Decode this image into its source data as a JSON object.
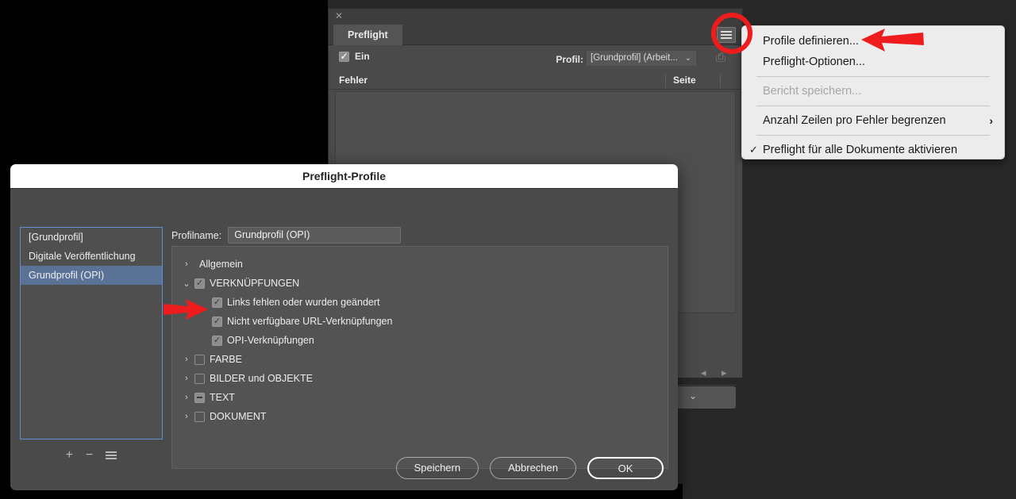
{
  "preflight_panel": {
    "close_icon": "close-icon",
    "collapse_icon": "collapse-panel-icon",
    "tab_label": "Preflight",
    "menu_icon": "panel-menu-icon",
    "enabled_label": "Ein",
    "enabled_checked": true,
    "profile_label": "Profil:",
    "profile_value": "[Grundprofil] (Arbeit...",
    "profile_chevron": "⌄",
    "embed_icon": "embed-profile-icon",
    "columns": [
      "Fehler",
      "Seite"
    ],
    "nav_prev_icon": "◂",
    "nav_next_icon": "▸",
    "info_chevron": "⌄"
  },
  "context_menu": {
    "items": [
      {
        "label": "Profile definieren...",
        "type": "item",
        "disabled": false,
        "checked": false,
        "submenu": false
      },
      {
        "label": "Preflight-Optionen...",
        "type": "item",
        "disabled": false,
        "checked": false,
        "submenu": false
      },
      {
        "label": "",
        "type": "separator"
      },
      {
        "label": "Bericht speichern...",
        "type": "item",
        "disabled": true,
        "checked": false,
        "submenu": false
      },
      {
        "label": "",
        "type": "separator"
      },
      {
        "label": "Anzahl Zeilen pro Fehler begrenzen",
        "type": "item",
        "disabled": false,
        "checked": false,
        "submenu": true,
        "submenu_icon": "›"
      },
      {
        "label": "",
        "type": "separator"
      },
      {
        "label": "Preflight für alle Dokumente aktivieren",
        "type": "item",
        "disabled": false,
        "checked": true,
        "check_icon": "✓",
        "submenu": false
      }
    ]
  },
  "dialog": {
    "title": "Preflight-Profile",
    "profile_list": [
      {
        "label": "[Grundprofil]",
        "selected": false
      },
      {
        "label": "Digitale Veröffentlichung",
        "selected": false
      },
      {
        "label": "Grundprofil (OPI)",
        "selected": true
      }
    ],
    "list_tools": {
      "add_icon": "+",
      "remove_icon": "−",
      "menu_icon": "list-menu-icon"
    },
    "profile_name_label": "Profilname:",
    "profile_name_value": "Grundprofil (OPI)",
    "tree": [
      {
        "label": "Allgemein",
        "level": 0,
        "twisty": "›",
        "expanded": false,
        "checkbox": "none"
      },
      {
        "label": "VERKNÜPFUNGEN",
        "level": 0,
        "twisty": "⌄",
        "expanded": true,
        "checkbox": "checked"
      },
      {
        "label": "Links fehlen oder wurden geändert",
        "level": 1,
        "twisty": "",
        "expanded": false,
        "checkbox": "checked"
      },
      {
        "label": "Nicht verfügbare URL-Verknüpfungen",
        "level": 1,
        "twisty": "",
        "expanded": false,
        "checkbox": "checked"
      },
      {
        "label": "OPI-Verknüpfungen",
        "level": 1,
        "twisty": "",
        "expanded": false,
        "checkbox": "checked"
      },
      {
        "label": "FARBE",
        "level": 0,
        "twisty": "›",
        "expanded": false,
        "checkbox": "unchecked"
      },
      {
        "label": "BILDER und OBJEKTE",
        "level": 0,
        "twisty": "›",
        "expanded": false,
        "checkbox": "unchecked"
      },
      {
        "label": "TEXT",
        "level": 0,
        "twisty": "›",
        "expanded": false,
        "checkbox": "mixed"
      },
      {
        "label": "DOKUMENT",
        "level": 0,
        "twisty": "›",
        "expanded": false,
        "checkbox": "unchecked"
      }
    ],
    "buttons": {
      "save": "Speichern",
      "cancel": "Abbrechen",
      "ok": "OK"
    }
  },
  "annotations": {
    "highlight_color": "#ee1c1c",
    "circle_target": "panel-menu-icon",
    "arrow1_target": "Profile definieren...",
    "arrow2_target": "OPI-Verknüpfungen"
  }
}
